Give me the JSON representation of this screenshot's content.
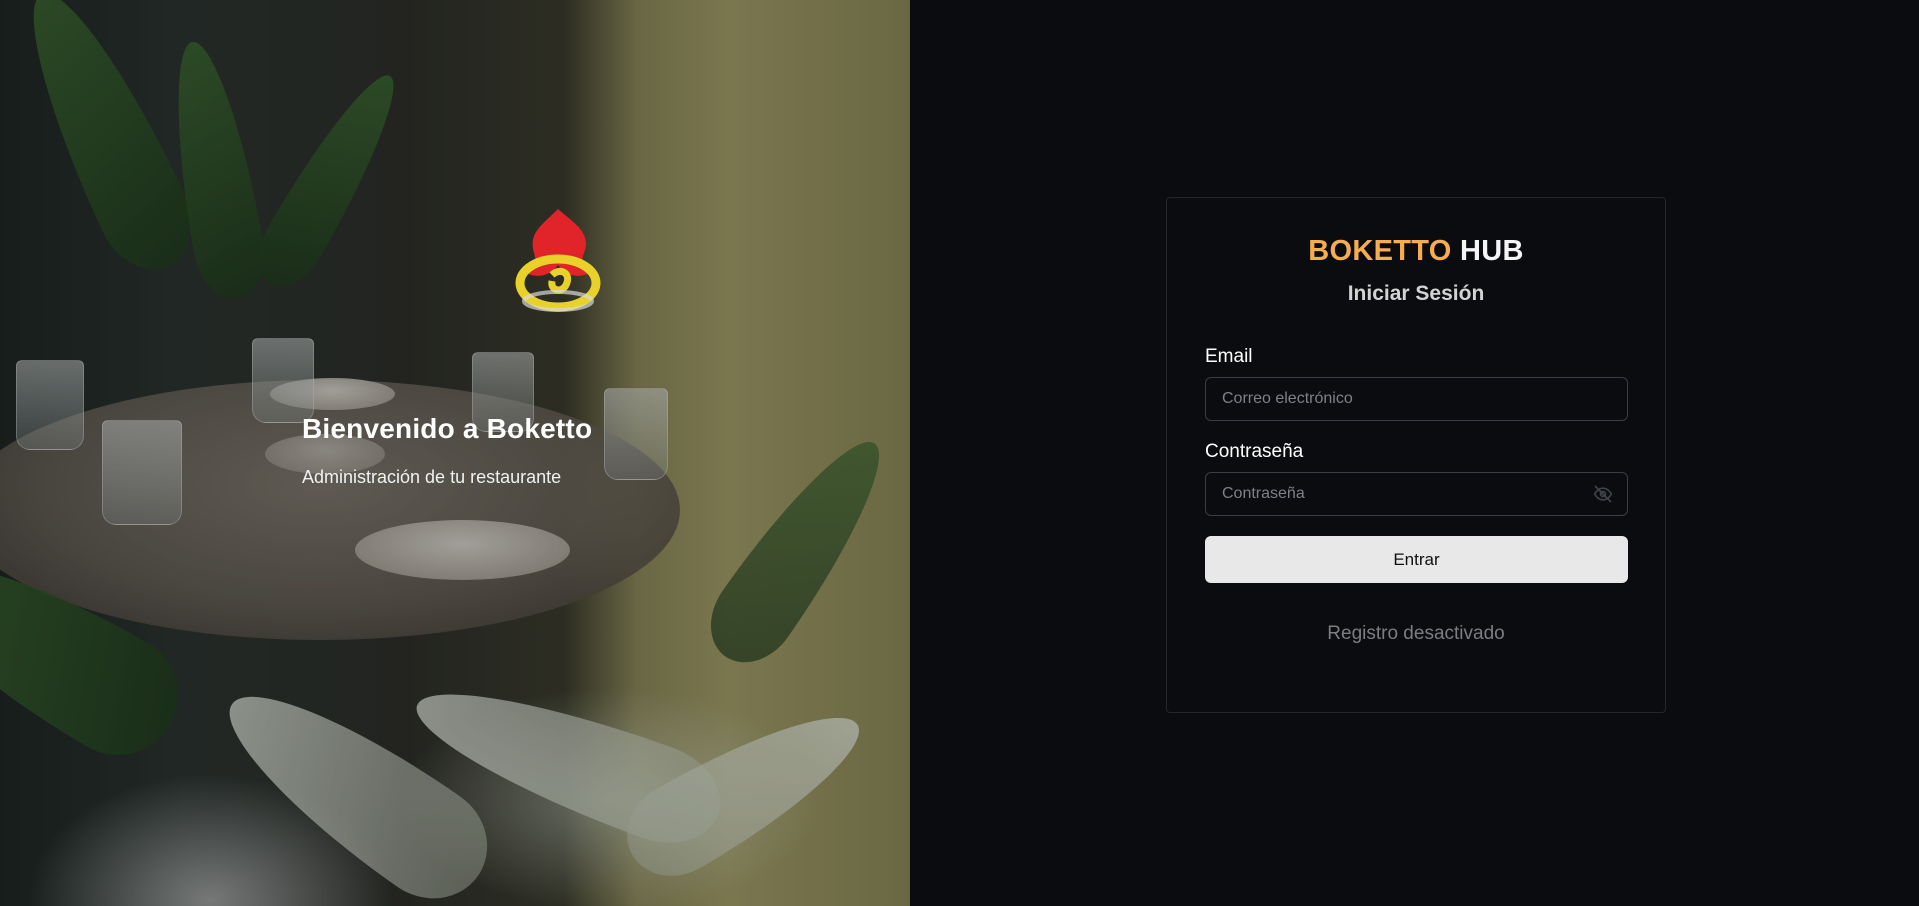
{
  "hero": {
    "title": "Bienvenido a Boketto",
    "subtitle": "Administración de tu restaurante"
  },
  "login": {
    "brand_accent": "BOKETTO",
    "brand_main": "HUB",
    "heading": "Iniciar Sesión",
    "email_label": "Email",
    "email_placeholder": "Correo electrónico",
    "email_value": "",
    "password_label": "Contraseña",
    "password_placeholder": "Contraseña",
    "password_value": "",
    "submit_label": "Entrar",
    "register_note": "Registro desactivado"
  },
  "icons": {
    "password_toggle": "eye-off-icon",
    "hero_logo": "neon-flame-logo"
  },
  "colors": {
    "brand_accent": "#f5ad4f",
    "background": "#0b0c0f",
    "button_bg": "#e8e8e8",
    "muted_text": "#7b7d82"
  }
}
